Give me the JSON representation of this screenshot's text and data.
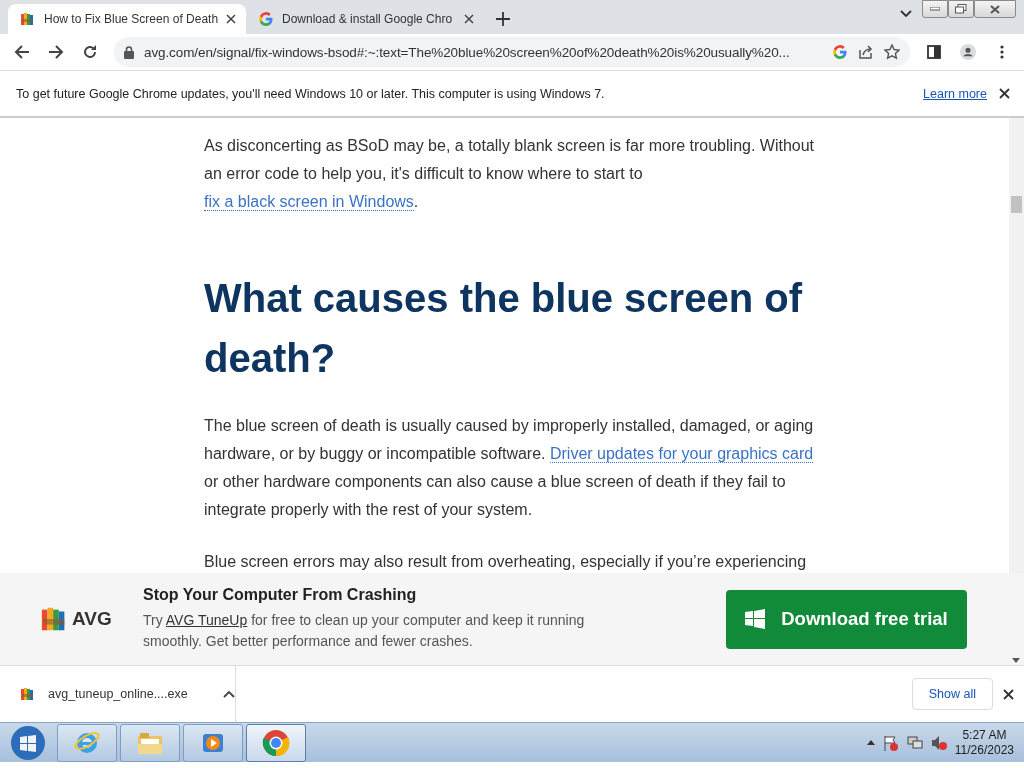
{
  "tabs": [
    {
      "title": "How to Fix Blue Screen of Death",
      "selected": true
    },
    {
      "title": "Download & install Google Chro",
      "selected": false
    }
  ],
  "address": "avg.com/en/signal/fix-windows-bsod#:~:text=The%20blue%20screen%20of%20death%20is%20usually%20...",
  "infobar": {
    "message": "To get future Google Chrome updates, you'll need Windows 10 or later. This computer is using Windows 7.",
    "link": "Learn more"
  },
  "article": [
    {
      "kind": "paragraph",
      "parts": [
        {
          "text": "As disconcerting as BSoD may be, a totally blank screen is far more troubling. Without an error code to help you, it's difficult to know where to start to "
        },
        {
          "text": "fix a black screen in Windows",
          "link": true
        },
        {
          "text": "."
        }
      ]
    },
    {
      "kind": "heading",
      "text": "What causes the blue screen of death?"
    },
    {
      "kind": "paragraph",
      "parts": [
        {
          "text": "The blue screen of death is usually caused by improperly installed, damaged, or aging hardware, or by buggy or incompatible software. "
        },
        {
          "text": "Driver updates for your graphics card",
          "link": true
        },
        {
          "text": " or other hardware components can also cause a blue screen of death if they fail to integrate properly with the rest of your system."
        }
      ]
    },
    {
      "kind": "paragraph",
      "parts": [
        {
          "text": "Blue screen errors may also result from overheating, especially if you’re experiencing"
        }
      ]
    }
  ],
  "banner": {
    "logo": "AVG",
    "title": "Stop Your Computer From Crashing",
    "text_before": "Try ",
    "link": "AVG TuneUp",
    "text_after": " for free to clean up your computer and keep it running smoothly. Get better performance and fewer crashes.",
    "button": "Download free trial"
  },
  "downloads": {
    "file": "avg_tuneup_online....exe",
    "show_all": "Show all"
  },
  "taskbar": {
    "apps": [
      {
        "kind": "ie",
        "selected": false
      },
      {
        "kind": "explorer",
        "selected": false
      },
      {
        "kind": "media",
        "selected": false
      },
      {
        "kind": "chrome",
        "selected": true
      }
    ],
    "time": "5:27 AM",
    "date": "11/26/2023"
  }
}
